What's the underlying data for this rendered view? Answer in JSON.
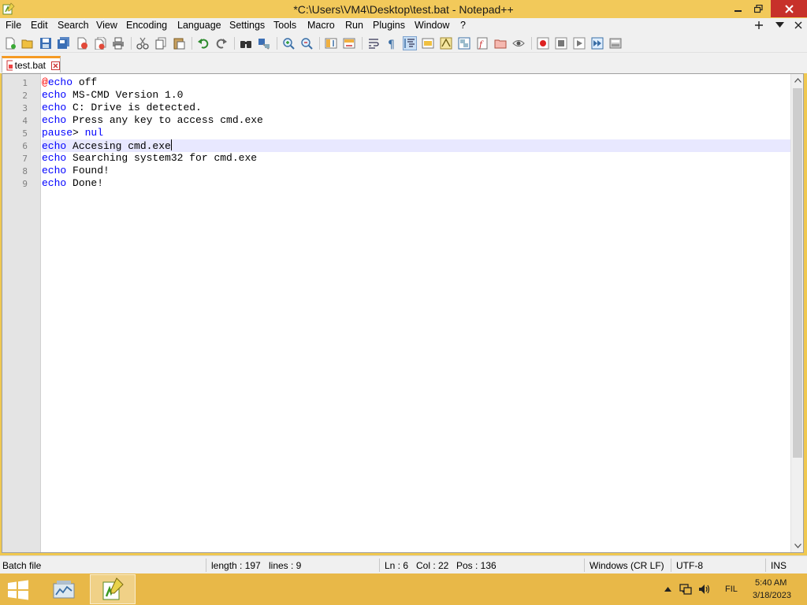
{
  "window": {
    "title": "*C:\\Users\\VM4\\Desktop\\test.bat - Notepad++"
  },
  "menu": {
    "items": [
      "File",
      "Edit",
      "Search",
      "View",
      "Encoding",
      "Language",
      "Settings",
      "Tools",
      "Macro",
      "Run",
      "Plugins",
      "Window",
      "?"
    ]
  },
  "tabs": [
    {
      "label": "test.bat",
      "modified": true
    }
  ],
  "editor": {
    "lines": [
      {
        "num": "1",
        "tokens": [
          {
            "t": "@",
            "c": "at"
          },
          {
            "t": "echo",
            "c": "kw"
          },
          {
            "t": " off",
            "c": "txt"
          }
        ]
      },
      {
        "num": "2",
        "tokens": [
          {
            "t": "echo",
            "c": "kw"
          },
          {
            "t": " MS-CMD Version 1.0",
            "c": "txt"
          }
        ]
      },
      {
        "num": "3",
        "tokens": [
          {
            "t": "echo",
            "c": "kw"
          },
          {
            "t": " C: Drive is detected.",
            "c": "txt"
          }
        ]
      },
      {
        "num": "4",
        "tokens": [
          {
            "t": "echo",
            "c": "kw"
          },
          {
            "t": " Press any key to access cmd.exe",
            "c": "txt"
          }
        ]
      },
      {
        "num": "5",
        "tokens": [
          {
            "t": "pause",
            "c": "kw"
          },
          {
            "t": "> ",
            "c": "txt"
          },
          {
            "t": "nul",
            "c": "kw"
          }
        ]
      },
      {
        "num": "6",
        "tokens": [
          {
            "t": "echo",
            "c": "kw"
          },
          {
            "t": " Accesing cmd.exe",
            "c": "txt"
          }
        ],
        "current": true
      },
      {
        "num": "7",
        "tokens": [
          {
            "t": "echo",
            "c": "kw"
          },
          {
            "t": " Searching system32 for cmd.exe",
            "c": "txt"
          }
        ]
      },
      {
        "num": "8",
        "tokens": [
          {
            "t": "echo",
            "c": "kw"
          },
          {
            "t": " Found!",
            "c": "txt"
          }
        ]
      },
      {
        "num": "9",
        "tokens": [
          {
            "t": "echo",
            "c": "kw"
          },
          {
            "t": " Done!",
            "c": "txt"
          }
        ]
      }
    ]
  },
  "status": {
    "filetype": "Batch file",
    "length": "length : 197",
    "lines": "lines : 9",
    "ln": "Ln : 6",
    "col": "Col : 22",
    "pos": "Pos : 136",
    "eol": "Windows (CR LF)",
    "encoding": "UTF-8",
    "mode": "INS"
  },
  "taskbar": {
    "tray_lang": "FIL",
    "time": "5:40 AM",
    "date": "3/18/2023"
  },
  "colors": {
    "keyword": "#0000ff",
    "at_sign": "#ff0000",
    "title_bg": "#f2c95a",
    "taskbar_bg": "#e8b848",
    "current_line": "#e8e8ff"
  }
}
